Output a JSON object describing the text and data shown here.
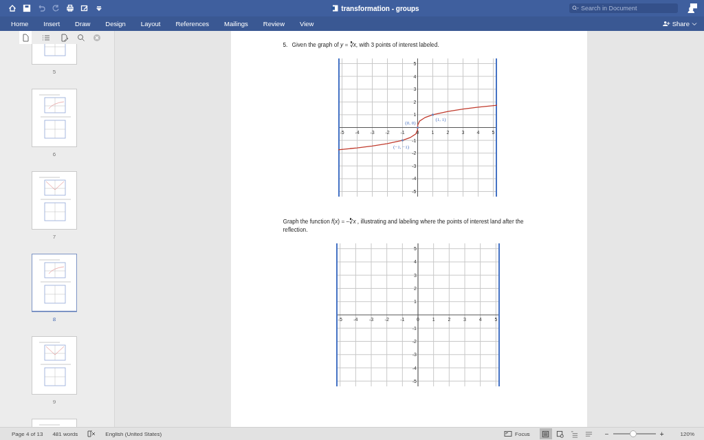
{
  "window": {
    "title": "transformation - groups"
  },
  "search": {
    "placeholder": "Search in Document"
  },
  "ribbon_tabs": [
    {
      "label": "Home"
    },
    {
      "label": "Insert"
    },
    {
      "label": "Draw"
    },
    {
      "label": "Design"
    },
    {
      "label": "Layout"
    },
    {
      "label": "References"
    },
    {
      "label": "Mailings"
    },
    {
      "label": "Review"
    },
    {
      "label": "View"
    }
  ],
  "share": {
    "label": "Share"
  },
  "sidebar": {
    "tools": [
      {
        "kind": "thumbnails",
        "selected": true
      },
      {
        "kind": "outline",
        "selected": false
      }
    ],
    "pages": [
      {
        "number": "5",
        "selected": false
      },
      {
        "number": "6",
        "selected": false
      },
      {
        "number": "7",
        "selected": false
      },
      {
        "number": "8",
        "selected": true
      },
      {
        "number": "9",
        "selected": false
      },
      {
        "selected": false
      }
    ]
  },
  "document": {
    "items": [
      {
        "kind": "question",
        "number": "5.",
        "text": "Given the graph of *y* = ∛*x*, with 3 points of interest labeled.",
        "chart_data": {
          "type": "line",
          "grid": true,
          "xlim": [
            -5.25,
            5.25
          ],
          "ylim": [
            -5.4,
            5.4
          ],
          "xticks": [
            -5,
            -4,
            -3,
            -2,
            -1,
            0,
            1,
            2,
            3,
            4,
            5
          ],
          "yticks": [
            -5,
            -4,
            -3,
            -2,
            -1,
            1,
            2,
            3,
            4,
            5
          ],
          "x": [
            -5.25,
            -4,
            -3,
            -2,
            -1,
            -0.5,
            -0.125,
            -0.008,
            0,
            0.008,
            0.125,
            0.5,
            1,
            2,
            3,
            4,
            5.25
          ],
          "series": [
            {
              "color": "#c0392b",
              "values": [
                -1.74,
                -1.59,
                -1.44,
                -1.26,
                -1,
                -0.79,
                -0.5,
                -0.2,
                0,
                0.2,
                0.5,
                0.79,
                1,
                1.26,
                1.44,
                1.59,
                1.74
              ]
            }
          ],
          "annotations": [
            {
              "x": 0,
              "y": 0,
              "text": "(0, 0)"
            },
            {
              "x": 1,
              "y": 1,
              "text": "(1, 1)"
            },
            {
              "x": -1,
              "y": -1,
              "text": "(−1, −1)"
            }
          ]
        }
      },
      {
        "kind": "question",
        "text": "Graph the function *f*(*x*) = −∛*x* , illustrating and labeling where the points of interest land after the reflection.",
        "chart_data": {
          "type": "line",
          "grid": true,
          "xlim": [
            -5.25,
            5.25
          ],
          "ylim": [
            -5.4,
            5.4
          ],
          "xticks": [
            -5,
            -4,
            -3,
            -2,
            -1,
            0,
            1,
            2,
            3,
            4,
            5
          ],
          "yticks": [
            -5,
            -4,
            -3,
            -2,
            -1,
            1,
            2,
            3,
            4,
            5
          ]
        }
      }
    ]
  },
  "status_bar": {
    "page": "Page 4 of 13",
    "words": "481 words",
    "language": "English (United States)",
    "focus": "Focus",
    "views": [
      {
        "kind": "print",
        "selected": true
      },
      {
        "kind": "web",
        "selected": false
      },
      {
        "kind": "outline",
        "selected": false
      },
      {
        "kind": "draft",
        "selected": false
      }
    ],
    "zoom_out": "−",
    "zoom_in": "+",
    "zoom": {
      "level": 0.47
    },
    "zoom_reading": "120%"
  }
}
